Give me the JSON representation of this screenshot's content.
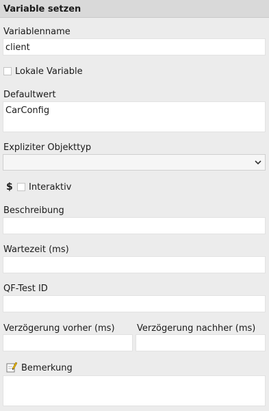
{
  "header": {
    "title": "Variable setzen"
  },
  "variable_name": {
    "label": "Variablenname",
    "value": "client"
  },
  "local_variable": {
    "label": "Lokale Variable",
    "checked": false
  },
  "default_value": {
    "label": "Defaultwert",
    "value": "CarConfig"
  },
  "explicit_type": {
    "label": "Expliziter Objekttyp",
    "selected": ""
  },
  "interactive": {
    "dollar": "$",
    "label": "Interaktiv",
    "checked": false
  },
  "description": {
    "label": "Beschreibung",
    "value": ""
  },
  "wait_time": {
    "label": "Wartezeit (ms)",
    "value": ""
  },
  "qftest_id": {
    "label": "QF-Test ID",
    "value": ""
  },
  "delay_before": {
    "label": "Verzögerung vorher (ms)",
    "value": ""
  },
  "delay_after": {
    "label": "Verzögerung nachher (ms)",
    "value": ""
  },
  "remark": {
    "label": "Bemerkung",
    "icon": "edit-note-icon",
    "value": ""
  }
}
